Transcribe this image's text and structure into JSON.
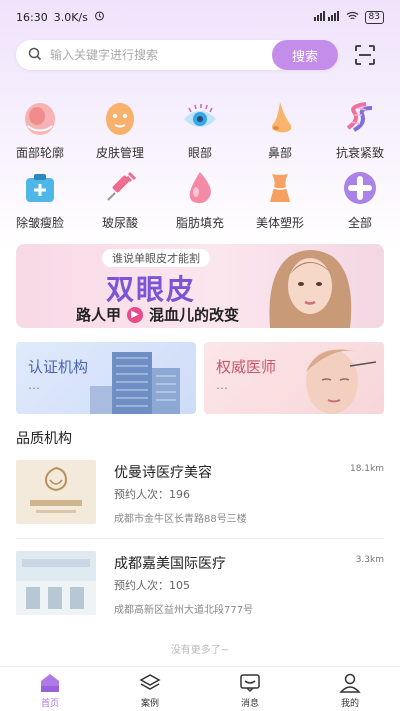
{
  "status_bar": {
    "time": "16:30",
    "speed": "3.0K/s",
    "battery": "83"
  },
  "search": {
    "placeholder": "输入关键字进行搜索",
    "button_label": "搜索"
  },
  "categories": [
    {
      "label": "面部轮廓",
      "icon": "face-contour-icon"
    },
    {
      "label": "皮肤管理",
      "icon": "skin-mask-icon"
    },
    {
      "label": "眼部",
      "icon": "eye-icon"
    },
    {
      "label": "鼻部",
      "icon": "nose-icon"
    },
    {
      "label": "抗衰紧致",
      "icon": "dna-icon"
    },
    {
      "label": "除皱瘦脸",
      "icon": "medical-kit-icon"
    },
    {
      "label": "玻尿酸",
      "icon": "syringe-icon"
    },
    {
      "label": "脂肪填充",
      "icon": "fat-drop-icon"
    },
    {
      "label": "美体塑形",
      "icon": "body-shape-icon"
    },
    {
      "label": "全部",
      "icon": "plus-circle-icon"
    }
  ],
  "banner": {
    "tag": "谁说单眼皮才能割",
    "title": "双眼皮",
    "subtitle_left": "路人甲",
    "subtitle_right": "混血儿的改变"
  },
  "feature_cards": [
    {
      "title": "认证机构",
      "dots": "…"
    },
    {
      "title": "权威医师",
      "dots": "…"
    }
  ],
  "section_title": "品质机构",
  "institutions": [
    {
      "name": "优曼诗医疗美容",
      "distance": "18.1km",
      "appointments": "预约人次：196",
      "address": "成都市金牛区长青路88号三楼"
    },
    {
      "name": "成都嘉美国际医疗",
      "distance": "3.3km",
      "appointments": "预约人次：105",
      "address": "成都高新区益州大道北段777号"
    }
  ],
  "no_more_text": "没有更多了~",
  "tabs": [
    {
      "label": "首页",
      "icon": "home-icon",
      "active": true
    },
    {
      "label": "案例",
      "icon": "cases-icon",
      "active": false
    },
    {
      "label": "消息",
      "icon": "message-icon",
      "active": false
    },
    {
      "label": "我的",
      "icon": "profile-icon",
      "active": false
    }
  ],
  "colors": {
    "accent": "#c38de9",
    "tab_active": "#b07ae6",
    "banner_title": "#7b55d6"
  }
}
